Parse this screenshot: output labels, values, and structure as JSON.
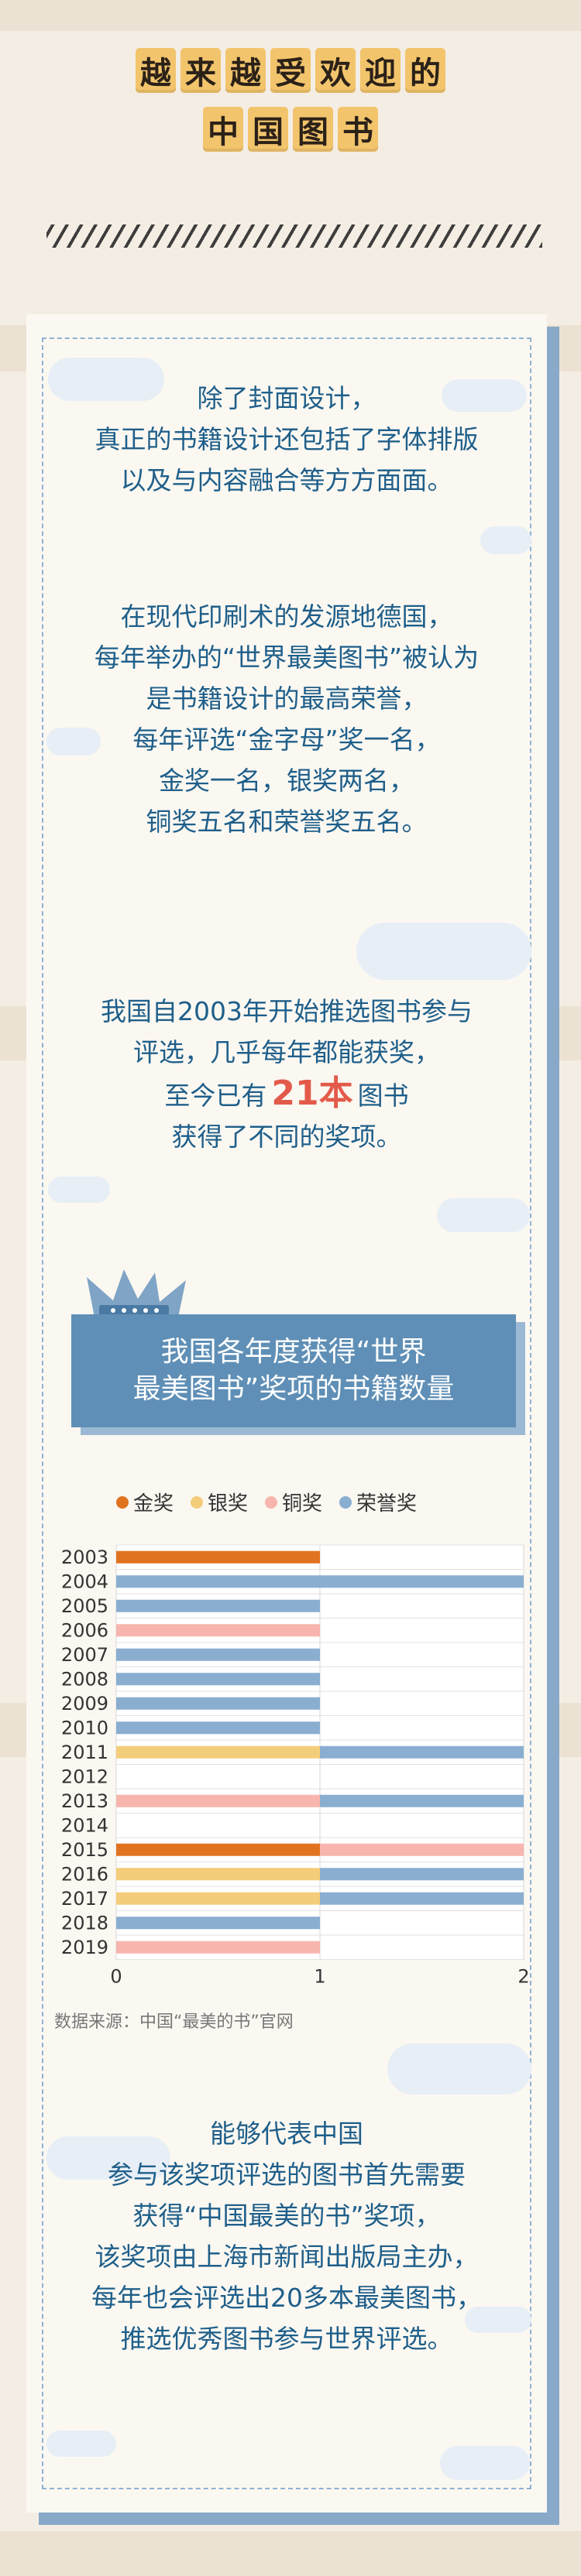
{
  "title": {
    "line1": [
      "越",
      "来",
      "越",
      "受",
      "欢",
      "迎",
      "的"
    ],
    "line2": [
      "中",
      "国",
      "图",
      "书"
    ]
  },
  "intro": {
    "p1": [
      "除了封面设计，",
      "真正的书籍设计还包括了字体排版",
      "以及与内容融合等方方面面。"
    ],
    "p2": [
      "在现代印刷术的发源地德国，",
      "每年举办的“世界最美图书”被认为",
      "是书籍设计的最高荣誉，",
      "每年评选“金字母”奖一名，",
      "金奖一名，银奖两名，",
      "铜奖五名和荣誉奖五名。"
    ],
    "p3_line1": "我国自2003年开始推选图书参与",
    "p3_line2": "评选，几乎每年都能获奖，",
    "p3_line3_pre": "至今已有",
    "p3_highlight": "21本",
    "p3_line3_post": "图书",
    "p3_line4": "获得了不同的奖项。"
  },
  "banner": {
    "line1": "我国各年度获得“世界",
    "line2": "最美图书”奖项的书籍数量"
  },
  "chart_data": {
    "type": "bar",
    "orientation": "horizontal",
    "stacked": true,
    "categories": [
      "2003",
      "2004",
      "2005",
      "2006",
      "2007",
      "2008",
      "2009",
      "2010",
      "2011",
      "2012",
      "2013",
      "2014",
      "2015",
      "2016",
      "2017",
      "2018",
      "2019"
    ],
    "series": [
      {
        "name": "金奖",
        "color": "#e07320",
        "values": [
          1,
          0,
          0,
          0,
          0,
          0,
          0,
          0,
          0,
          0,
          0,
          0,
          1,
          0,
          0,
          0,
          0
        ]
      },
      {
        "name": "银奖",
        "color": "#f4cd7a",
        "values": [
          0,
          0,
          0,
          0,
          0,
          0,
          0,
          0,
          1,
          0,
          0,
          0,
          0,
          1,
          1,
          0,
          0
        ]
      },
      {
        "name": "铜奖",
        "color": "#f7b5ae",
        "values": [
          0,
          0,
          0,
          1,
          0,
          0,
          0,
          0,
          0,
          0,
          1,
          0,
          1,
          0,
          0,
          0,
          1
        ]
      },
      {
        "name": "荣誉奖",
        "color": "#8aaed0",
        "values": [
          0,
          2,
          1,
          0,
          1,
          1,
          1,
          1,
          1,
          0,
          1,
          0,
          0,
          1,
          1,
          1,
          0
        ]
      }
    ],
    "xlim": [
      0,
      2
    ],
    "xticks": [
      "0",
      "1",
      "2"
    ],
    "legend": "top",
    "grid": true
  },
  "source": "数据来源：中国“最美的书”官网",
  "outro": [
    "能够代表中国",
    "参与该奖项评选的图书首先需要",
    "获得“中国最美的书”奖项，",
    "该奖项由上海市新闻出版局主办，",
    "每年也会评选出20多本最美图书，",
    "推选优秀图书参与世界评选。"
  ]
}
